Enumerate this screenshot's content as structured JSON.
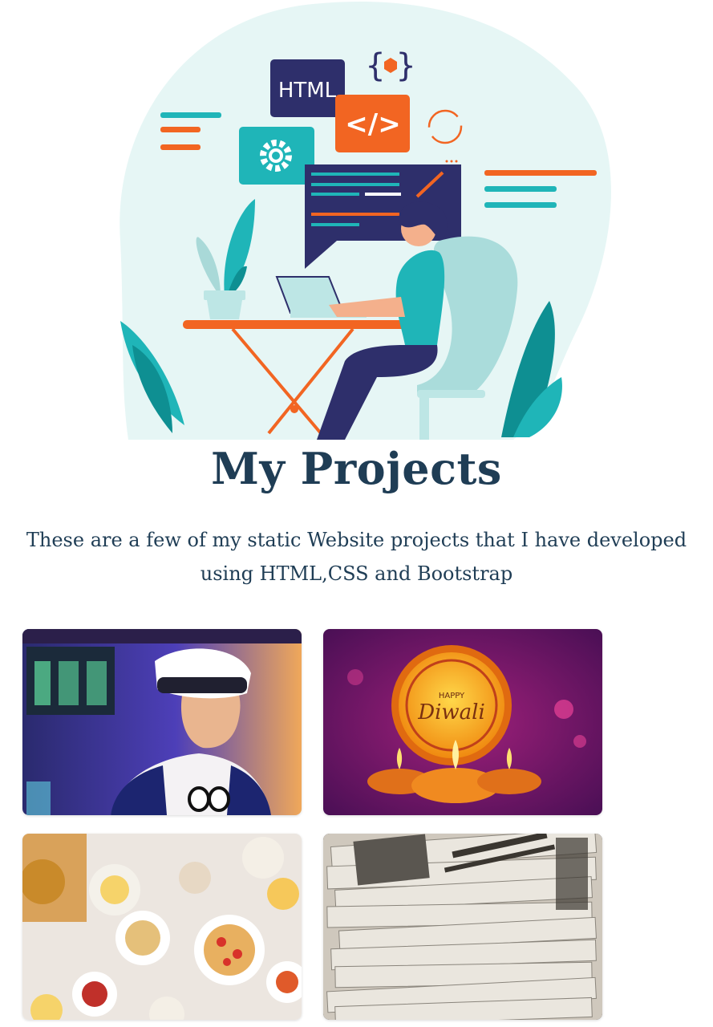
{
  "hero": {
    "html_tag": "HTML",
    "code_symbol": "</>",
    "braces_symbol": "{ }"
  },
  "heading": "My Projects",
  "description": "These are a few of my static Website projects that I have developed using HTML,CSS and Bootstrap",
  "projects": [
    {
      "image": "vr-headset-photo"
    },
    {
      "image": "happy-diwali-photo",
      "overlay_top": "HAPPY",
      "overlay_main": "Diwali"
    },
    {
      "image": "breakfast-table-photo"
    },
    {
      "image": "newspapers-photo"
    }
  ],
  "colors": {
    "heading": "#1f3d55",
    "accent_orange": "#f26522",
    "accent_teal": "#1fb5b8",
    "navy": "#2e2f6b"
  }
}
